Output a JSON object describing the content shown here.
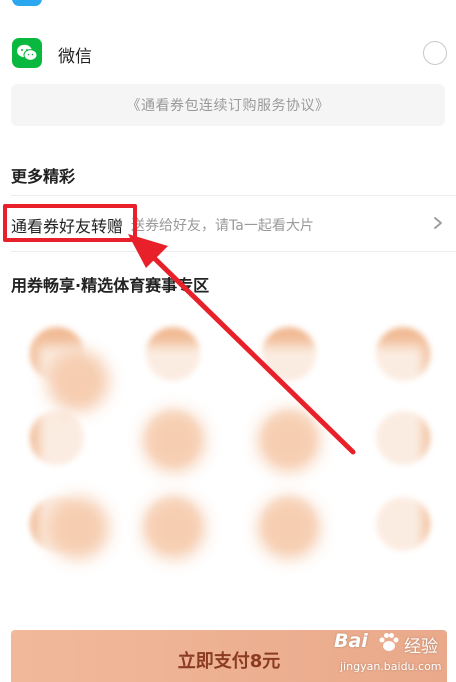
{
  "payment": {
    "wechat_label": "微信",
    "agreement": "《通看券包连续订购服务协议》"
  },
  "more_section": {
    "title": "更多精彩",
    "gift_title": "通看券好友转赠",
    "gift_desc": "送券给好友，请Ta一起看大片"
  },
  "sports_section": {
    "title": "用券畅享·精选体育赛事专区"
  },
  "checkout": {
    "pay_button": "立即支付8元"
  },
  "watermark": {
    "brand": "Bai",
    "jingyan": "经验",
    "url": "jingyan.baidu.com"
  },
  "colors": {
    "wechat": "#09b83e",
    "highlight": "#e8202a",
    "pay_button": "#eeb394"
  },
  "icons": {
    "wechat": "wechat-icon",
    "chevron": "chevron-right-icon",
    "radio": "radio-unselected-icon"
  }
}
